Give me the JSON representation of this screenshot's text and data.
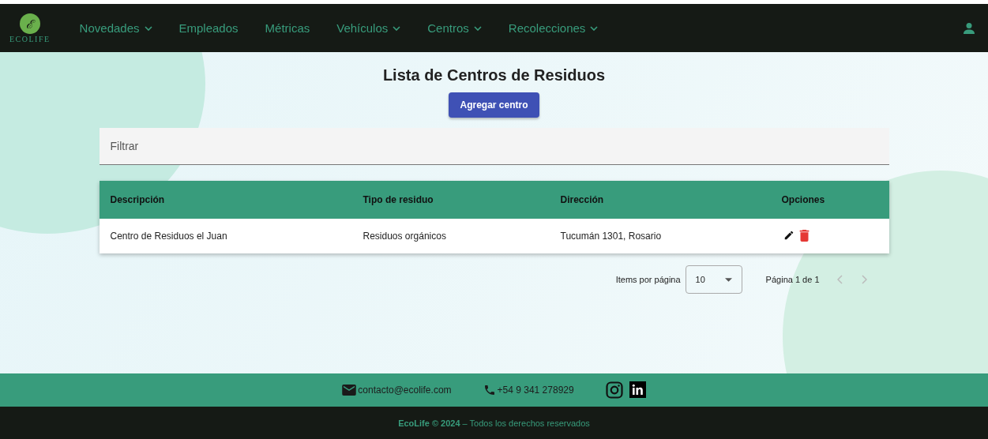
{
  "logo": {
    "letter": "ℰ",
    "text": "ECOLIFE"
  },
  "nav": [
    {
      "label": "Novedades",
      "dropdown": true
    },
    {
      "label": "Empleados",
      "dropdown": false
    },
    {
      "label": "Métricas",
      "dropdown": false
    },
    {
      "label": "Vehículos",
      "dropdown": true
    },
    {
      "label": "Centros",
      "dropdown": true
    },
    {
      "label": "Recolecciones",
      "dropdown": true
    }
  ],
  "title": "Lista de Centros de Residuos",
  "add_button": "Agregar centro",
  "filter": {
    "placeholder": "Filtrar"
  },
  "table": {
    "columns": [
      "Descripción",
      "Tipo de residuo",
      "Dirección",
      "Opciones"
    ],
    "rows": [
      {
        "cells": [
          "Centro de Residuos el Juan",
          "Residuos orgánicos",
          "Tucumán 1301, Rosario"
        ]
      }
    ]
  },
  "paginator": {
    "label": "Items por página",
    "page_size": "10",
    "range": "Página 1 de 1",
    "prev_disabled": true,
    "next_disabled": true
  },
  "footer": {
    "email": "contacto@ecolife.com",
    "phone": "+54 9 341 278929",
    "copyright": "**EcoLife © 2024** – Todos los derechos reservados"
  }
}
